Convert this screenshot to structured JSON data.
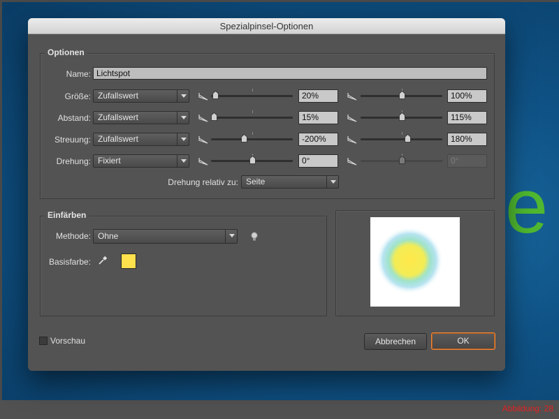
{
  "dialog": {
    "title": "Spezialpinsel-Optionen"
  },
  "options": {
    "legend": "Optionen",
    "name_label": "Name:",
    "name_value": "Lichtspot",
    "rows": [
      {
        "label": "Größe:",
        "mode": "Zufallswert",
        "min_value": "20%",
        "max_value": "100%",
        "min_level": 0.05,
        "max_level": 0.5,
        "max_disabled": false
      },
      {
        "label": "Abstand:",
        "mode": "Zufallswert",
        "min_value": "15%",
        "max_value": "115%",
        "min_level": 0.03,
        "max_level": 0.5,
        "max_disabled": false
      },
      {
        "label": "Streuung:",
        "mode": "Zufallswert",
        "min_value": "-200%",
        "max_value": "180%",
        "min_level": 0.4,
        "max_level": 0.57,
        "max_disabled": false
      },
      {
        "label": "Drehung:",
        "mode": "Fixiert",
        "min_value": "0°",
        "max_value": "0°",
        "min_level": 0.5,
        "max_level": 0.5,
        "max_disabled": true
      }
    ],
    "rotation_relative_label": "Drehung relativ zu:",
    "rotation_relative_value": "Seite"
  },
  "colorize": {
    "legend": "Einfärben",
    "method_label": "Methode:",
    "method_value": "Ohne",
    "base_color_label": "Basisfarbe:",
    "base_color": "#ffe04d"
  },
  "preview": {
    "toggle_label": "Vorschau",
    "checked": false
  },
  "buttons": {
    "cancel": "Abbrechen",
    "ok": "OK"
  },
  "caption": "Abbildung: 28",
  "backdrop": {
    "letter": "e"
  },
  "icons": {
    "mode": "pressure-mode-icon",
    "tip": "lightbulb-tip-icon",
    "eyedropper": "eyedropper-icon"
  }
}
